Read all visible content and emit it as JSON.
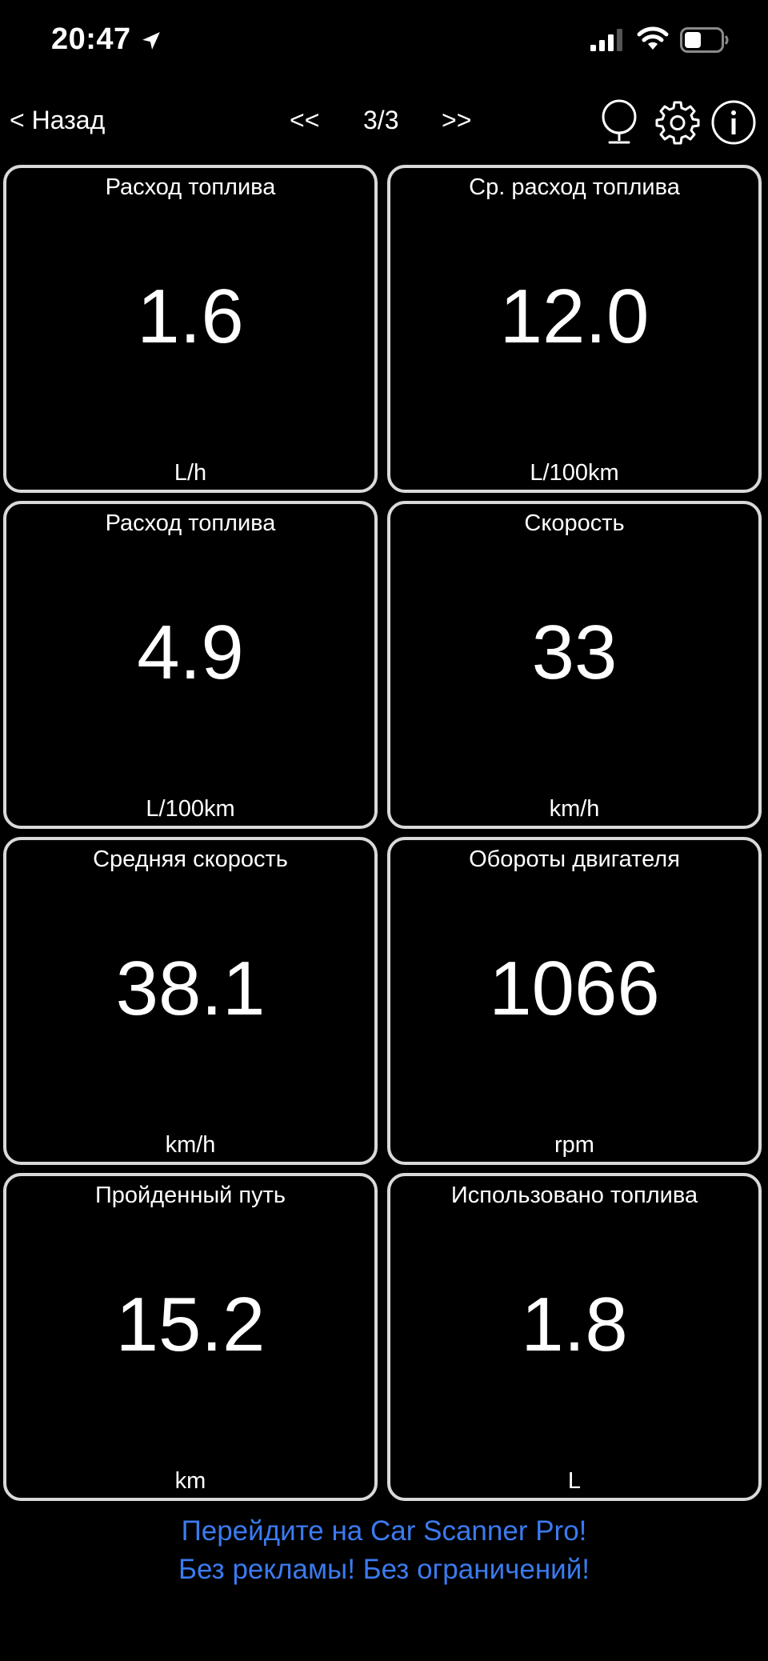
{
  "status": {
    "time": "20:47"
  },
  "nav": {
    "back": "< Назад",
    "prev": "<<",
    "page": "3/3",
    "next": ">>"
  },
  "tiles": [
    {
      "title": "Расход топлива",
      "value": "1.6",
      "unit": "L/h"
    },
    {
      "title": "Ср. расход топлива",
      "value": "12.0",
      "unit": "L/100km"
    },
    {
      "title": "Расход топлива",
      "value": "4.9",
      "unit": "L/100km"
    },
    {
      "title": "Скорость",
      "value": "33",
      "unit": "km/h"
    },
    {
      "title": "Средняя скорость",
      "value": "38.1",
      "unit": "km/h"
    },
    {
      "title": "Обороты двигателя",
      "value": "1066",
      "unit": "rpm"
    },
    {
      "title": "Пройденный путь",
      "value": "15.2",
      "unit": "km"
    },
    {
      "title": "Использовано топлива",
      "value": "1.8",
      "unit": "L"
    }
  ],
  "promo": {
    "line1": "Перейдите на Car Scanner Pro!",
    "line2": "Без рекламы! Без ограничений!"
  },
  "colors": {
    "background": "#000000",
    "tile_border": "#d9d9d9",
    "promo_link": "#3b7bf0",
    "text": "#ffffff"
  }
}
